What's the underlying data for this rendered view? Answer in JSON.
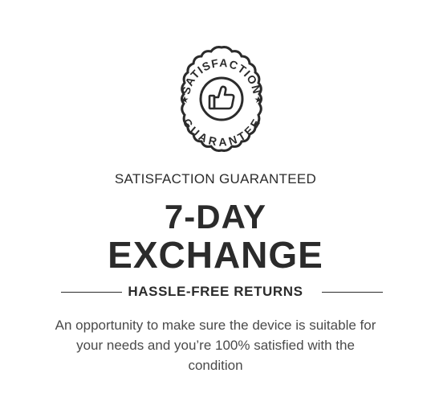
{
  "badge": {
    "icon": "thumbs-up-icon",
    "arc_top": "SATISFACTION",
    "arc_bottom": "GUARANTEE"
  },
  "kicker": "SATISFACTION GUARANTEED",
  "headline": {
    "line1": "7-DAY",
    "line2": "EXCHANGE"
  },
  "subhead": "HASSLE-FREE RETURNS",
  "description": "An opportunity to make sure the device is suitable for your needs and you’re 100% satisfied with the condition",
  "colors": {
    "text": "#2b2b2b",
    "body_text": "#4a4a4a",
    "background": "#ffffff"
  }
}
